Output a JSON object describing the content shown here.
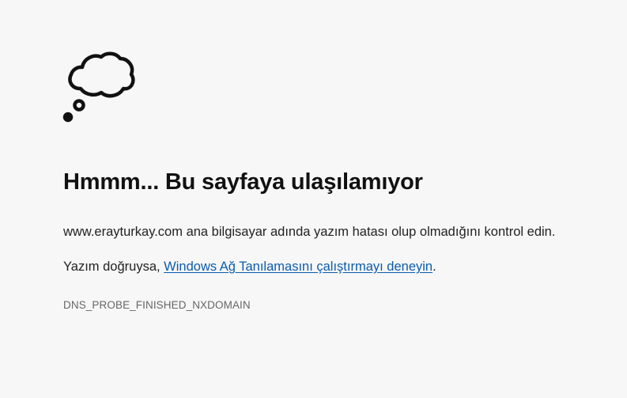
{
  "icon": "thought-bubble-icon",
  "title": "Hmmm... Bu sayfaya ulaşılamıyor",
  "message": {
    "host_check": "www.erayturkay.com ana bilgisayar adında yazım hatası olup olmadığını kontrol edin."
  },
  "suggestion": {
    "prefix": "Yazım doğruysa, ",
    "link_text": "Windows Ağ Tanılamasını çalıştırmayı deneyin",
    "suffix": "."
  },
  "error_code": "DNS_PROBE_FINISHED_NXDOMAIN",
  "colors": {
    "background": "#f7f7f7",
    "link": "#0b5cad",
    "error_code": "#666666"
  }
}
